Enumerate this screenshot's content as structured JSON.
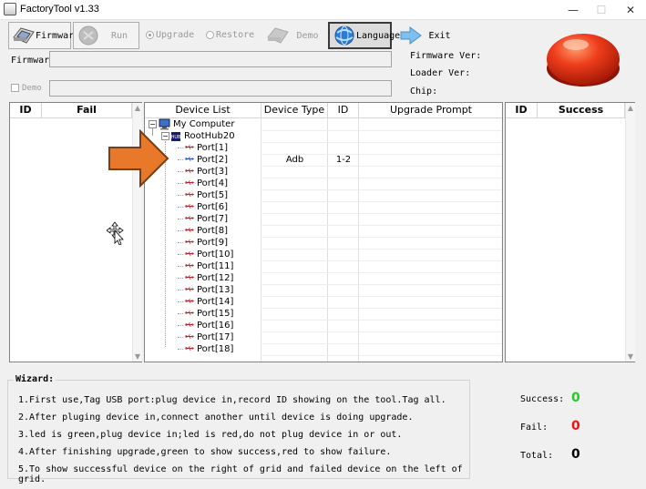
{
  "window": {
    "title": "FactoryTool v1.33",
    "minimize": "—",
    "maximize": "☐",
    "close": "✕"
  },
  "toolbar": {
    "firmware_label": "Firmware",
    "run_label": "Run",
    "upgrade_label": "Upgrade",
    "restore_label": "Restore",
    "demo_label": "Demo",
    "language_label": "Language",
    "exit_label": "Exit"
  },
  "fields": {
    "firmware_label": "Firmware",
    "firmware_value": "",
    "demo_label": "Demo",
    "demo_value": ""
  },
  "info": {
    "firmware_ver": "Firmware Ver:",
    "loader_ver": "Loader Ver:",
    "chip": "Chip:"
  },
  "fail_grid": {
    "columns": [
      "ID",
      "Fail"
    ]
  },
  "success_grid": {
    "columns": [
      "ID",
      "Success"
    ]
  },
  "device_grid": {
    "columns": [
      "Device List",
      "Device Type",
      "ID",
      "Upgrade Prompt"
    ],
    "root": "My Computer",
    "hub": "RootHub20",
    "ports": [
      {
        "name": "Port[1]",
        "type": "",
        "id": "",
        "active": false
      },
      {
        "name": "Port[2]",
        "type": "Adb",
        "id": "1-2",
        "active": true
      },
      {
        "name": "Port[3]",
        "type": "",
        "id": "",
        "active": false
      },
      {
        "name": "Port[4]",
        "type": "",
        "id": "",
        "active": false
      },
      {
        "name": "Port[5]",
        "type": "",
        "id": "",
        "active": false
      },
      {
        "name": "Port[6]",
        "type": "",
        "id": "",
        "active": false
      },
      {
        "name": "Port[7]",
        "type": "",
        "id": "",
        "active": false
      },
      {
        "name": "Port[8]",
        "type": "",
        "id": "",
        "active": false
      },
      {
        "name": "Port[9]",
        "type": "",
        "id": "",
        "active": false
      },
      {
        "name": "Port[10]",
        "type": "",
        "id": "",
        "active": false
      },
      {
        "name": "Port[11]",
        "type": "",
        "id": "",
        "active": false
      },
      {
        "name": "Port[12]",
        "type": "",
        "id": "",
        "active": false
      },
      {
        "name": "Port[13]",
        "type": "",
        "id": "",
        "active": false
      },
      {
        "name": "Port[14]",
        "type": "",
        "id": "",
        "active": false
      },
      {
        "name": "Port[15]",
        "type": "",
        "id": "",
        "active": false
      },
      {
        "name": "Port[16]",
        "type": "",
        "id": "",
        "active": false
      },
      {
        "name": "Port[17]",
        "type": "",
        "id": "",
        "active": false
      },
      {
        "name": "Port[18]",
        "type": "",
        "id": "",
        "active": false
      }
    ]
  },
  "wizard": {
    "title": "Wizard:",
    "lines": [
      "1.First use,Tag USB port:plug device in,record ID showing on the tool.Tag all.",
      "2.After pluging device in,connect another until device is doing upgrade.",
      "3.led is green,plug device in;led is red,do not plug device in or out.",
      "4.After finishing upgrade,green to show success,red to show failure.",
      "5.To show successful device on the right of grid and failed device on the left of grid."
    ]
  },
  "stats": {
    "success_label": "Success:",
    "success_value": "0",
    "fail_label": "Fail:",
    "fail_value": "0",
    "total_label": "Total:",
    "total_value": "0"
  },
  "colors": {
    "success": "#22cc22",
    "fail": "#ee1111",
    "arrow": "#e8782a",
    "arrow_border": "#7a3e12",
    "port_idle": "#b4232a",
    "port_active": "#2b4ccc",
    "red_button": "#e83a1f"
  }
}
